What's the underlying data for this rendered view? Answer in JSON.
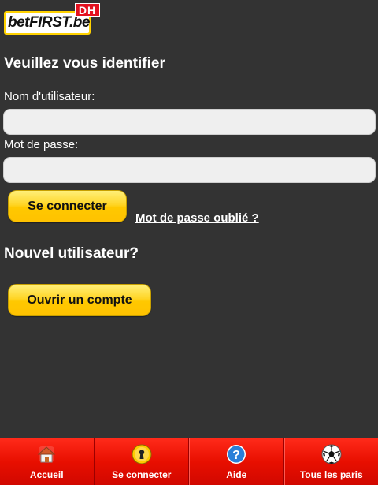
{
  "brand": {
    "logo_text_bet": "bet",
    "logo_text_first": "FIRST",
    "logo_text_be": ".be",
    "logo_badge": "DH"
  },
  "login": {
    "title": "Veuillez vous identifier",
    "username_label": "Nom d'utilisateur:",
    "username_value": "",
    "password_label": "Mot de passe:",
    "password_value": "",
    "submit_label": "Se connecter",
    "forgot_label": "Mot de passe oublié ?"
  },
  "register": {
    "title": "Nouvel utilisateur?",
    "open_account_label": "Ouvrir un compte"
  },
  "bottom_nav": {
    "items": [
      {
        "label": "Accueil",
        "icon": "home-icon"
      },
      {
        "label": "Se connecter",
        "icon": "keyhole-icon"
      },
      {
        "label": "Aide",
        "icon": "help-icon"
      },
      {
        "label": "Tous les paris",
        "icon": "football-icon"
      }
    ]
  },
  "colors": {
    "background": "#333333",
    "accent_yellow": "#ffd200",
    "nav_red": "#e80f00",
    "text": "#ffffff"
  }
}
